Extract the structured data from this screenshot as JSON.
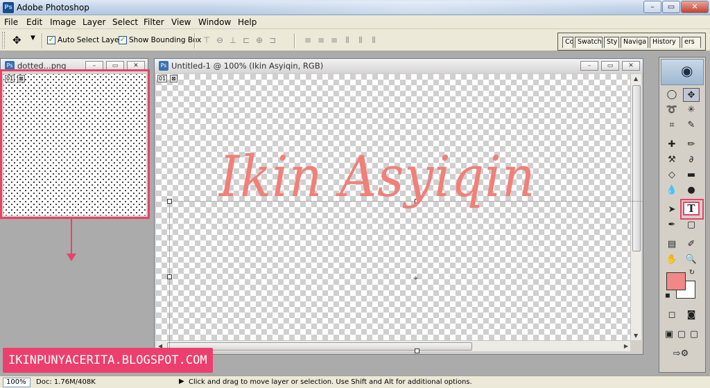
{
  "window": {
    "title": "Adobe Photoshop",
    "app_icon": "Ps"
  },
  "menu": [
    "File",
    "Edit",
    "Image",
    "Layer",
    "Select",
    "Filter",
    "View",
    "Window",
    "Help"
  ],
  "options_bar": {
    "tool_icon": "move-tool-icon",
    "auto_select_label": "Auto Select Layer",
    "auto_select_checked": true,
    "bounding_box_label": "Show Bounding Box",
    "bounding_box_checked": true,
    "palette_tabs": [
      "Co",
      "Swatch",
      "Sty",
      "Naviga",
      "History",
      "ers"
    ]
  },
  "documents": {
    "dotted": {
      "title": "dotted...png",
      "layer_chip": "01"
    },
    "untitled": {
      "title": "Untitled-1 @ 100% (Ikin Asyiqin, RGB)",
      "layer_chip": "01",
      "text_layer": "Ikin Asyiqin"
    }
  },
  "toolbox": {
    "type_tool_label": "T",
    "foreground_color": "#f28885",
    "background_color": "#ffffff"
  },
  "status": {
    "zoom": "100%",
    "doc_size": "Doc: 1.76M/408K",
    "hint": "Click and drag to move layer or selection.  Use Shift and Alt for additional options."
  },
  "annotation": {
    "watermark": "IKINPUNYACERITA.BLOGSPOT.COM",
    "accent": "#e8416a"
  }
}
